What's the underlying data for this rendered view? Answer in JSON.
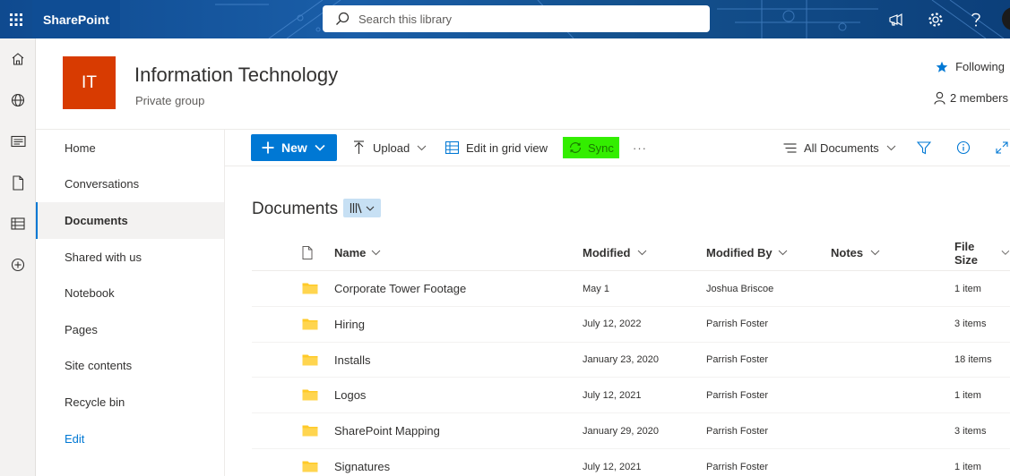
{
  "suite": {
    "brand": "SharePoint",
    "search_placeholder": "Search this library"
  },
  "site": {
    "logo_text": "IT",
    "title": "Information Technology",
    "subtitle": "Private group",
    "following_label": "Following",
    "members_label": "2 members"
  },
  "nav": {
    "items": [
      "Home",
      "Conversations",
      "Documents",
      "Shared with us",
      "Notebook",
      "Pages",
      "Site contents",
      "Recycle bin"
    ],
    "active": "Documents",
    "edit_label": "Edit"
  },
  "commands": {
    "new_label": "New",
    "upload_label": "Upload",
    "grid_label": "Edit in grid view",
    "sync_label": "Sync",
    "more_label": "···",
    "view_label": "All Documents"
  },
  "library": {
    "title": "Documents",
    "columns": {
      "name": "Name",
      "modified": "Modified",
      "modified_by": "Modified By",
      "notes": "Notes",
      "file_size": "File Size"
    },
    "rows": [
      {
        "name": "Corporate Tower Footage",
        "modified": "May 1",
        "modified_by": "Joshua Briscoe",
        "size": "1 item"
      },
      {
        "name": "Hiring",
        "modified": "July 12, 2022",
        "modified_by": "Parrish Foster",
        "size": "3 items"
      },
      {
        "name": "Installs",
        "modified": "January 23, 2020",
        "modified_by": "Parrish Foster",
        "size": "18 items"
      },
      {
        "name": "Logos",
        "modified": "July 12, 2021",
        "modified_by": "Parrish Foster",
        "size": "1 item"
      },
      {
        "name": "SharePoint Mapping",
        "modified": "January 29, 2020",
        "modified_by": "Parrish Foster",
        "size": "3 items"
      },
      {
        "name": "Signatures",
        "modified": "July 12, 2021",
        "modified_by": "Parrish Foster",
        "size": "1 item"
      }
    ]
  },
  "colors": {
    "accent": "#0078d4",
    "site_logo": "#d83b01",
    "folder": "#ffca28",
    "sync_highlight": "#33ee00"
  },
  "icons": [
    "waffle-icon",
    "search-icon",
    "megaphone-icon",
    "gear-icon",
    "help-icon",
    "home-icon",
    "globe-icon",
    "news-icon",
    "file-icon",
    "list-icon",
    "add-icon",
    "star-icon",
    "person-icon",
    "plus-icon",
    "chevron-down-icon",
    "upload-icon",
    "grid-icon",
    "sync-icon",
    "view-icon",
    "filter-icon",
    "info-icon",
    "expand-icon",
    "library-icon",
    "folder-icon"
  ]
}
